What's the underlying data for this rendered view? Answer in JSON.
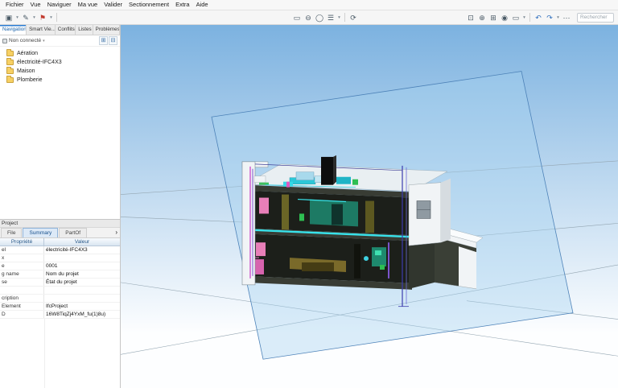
{
  "menubar": [
    "Fichier",
    "Vue",
    "Naviguer",
    "Ma vue",
    "Valider",
    "Sectionnement",
    "Extra",
    "Aide"
  ],
  "toolbar": {
    "left": [
      {
        "name": "copy",
        "glyph": "▣"
      },
      {
        "name": "copy-caret",
        "glyph": "▾"
      },
      {
        "name": "edit",
        "glyph": "✎"
      },
      {
        "name": "edit-caret",
        "glyph": "▾"
      },
      {
        "name": "flag",
        "glyph": "⚑"
      },
      {
        "name": "flag-caret",
        "glyph": "▾"
      }
    ],
    "middle": [
      {
        "name": "screen",
        "glyph": "▭"
      },
      {
        "name": "hide",
        "glyph": "⊖"
      },
      {
        "name": "circle",
        "glyph": "◯"
      },
      {
        "name": "list",
        "glyph": "☰"
      },
      {
        "name": "list-caret",
        "glyph": "▾"
      },
      {
        "name": "refresh",
        "glyph": "⟳"
      }
    ],
    "right": [
      {
        "name": "fit-view",
        "glyph": "⊡"
      },
      {
        "name": "zoom-in",
        "glyph": "⊕"
      },
      {
        "name": "zoom-window",
        "glyph": "⊞"
      },
      {
        "name": "orbit",
        "glyph": "◉"
      },
      {
        "name": "display",
        "glyph": "▭"
      },
      {
        "name": "display-caret",
        "glyph": "▾"
      },
      {
        "name": "undo",
        "glyph": "↶"
      },
      {
        "name": "redo",
        "glyph": "↷"
      },
      {
        "name": "redo-caret",
        "glyph": "▾"
      },
      {
        "name": "more",
        "glyph": "⋯"
      }
    ],
    "search_placeholder": "Rechercher"
  },
  "sidebar": {
    "tabs": [
      "Navigation",
      "Smart Vie...",
      "Conflits",
      "Listes",
      "Problèmes"
    ],
    "selected_tab": "Navigation",
    "status": "Non connecté",
    "status_caret": "▾",
    "tools": [
      {
        "name": "expand-all",
        "glyph": "⊞"
      },
      {
        "name": "collapse-all",
        "glyph": "⊟"
      }
    ],
    "tree": [
      "Aération",
      "électricité-IFC4X3",
      "Maison",
      "Plomberie"
    ]
  },
  "properties": {
    "title": "Project",
    "tabs": [
      "File",
      "Summary",
      "PartOf"
    ],
    "selected_tab": "Summary",
    "scroll_glyph": "›",
    "header": {
      "name": "Propriété",
      "value": "Valeur"
    },
    "rows": [
      {
        "label": "el",
        "value": "électricité-IFC4X3"
      },
      {
        "label": "x",
        "value": ""
      },
      {
        "label": "e",
        "value": "0001"
      },
      {
        "label": "g name",
        "value": "Nom du projet"
      },
      {
        "label": "se",
        "value": "État du projet"
      },
      {
        "label": "",
        "value": ""
      },
      {
        "label": "cription",
        "value": ""
      },
      {
        "label": "Element",
        "value": "IfcProject"
      },
      {
        "label": "D",
        "value": "16W8TiqZj4YxM_fu(1)8u)"
      }
    ]
  },
  "viewport": {
    "colors": {
      "bg_top": "#7cb2e0",
      "bg_bottom": "#fdfeff",
      "grid": "#93a5b1",
      "plane_fill": "#a5d2ef",
      "plane_edge": "#4d82b8",
      "wall": "#f1f4f6",
      "wall_shade": "#d6dce0",
      "roof": "#e9eff2",
      "slab": "#383c34",
      "interior": "#1c1f1a",
      "teal": "#1d7a64",
      "teal2": "#1e8a6e",
      "teal_light": "#3fe0b0",
      "olive": "#6a6526",
      "olive2": "#5c5820",
      "olive3": "#7a6a2a",
      "olive_dark": "#453c14",
      "pink": "#e87fb8",
      "pink2": "#d763ae",
      "magenta": "#cc55cc",
      "purple": "#7a55cc",
      "cyan": "#38e2ea",
      "cyan2": "#3fd2e2",
      "blue_col": "#3c3cae",
      "equip_blue": "#a8d9ec",
      "green": "#2ebf52",
      "black_unit": "#0d0d0d",
      "window": "#8f9aa2",
      "dark_under": "#3a3f36",
      "bridge": "#31362e"
    }
  }
}
